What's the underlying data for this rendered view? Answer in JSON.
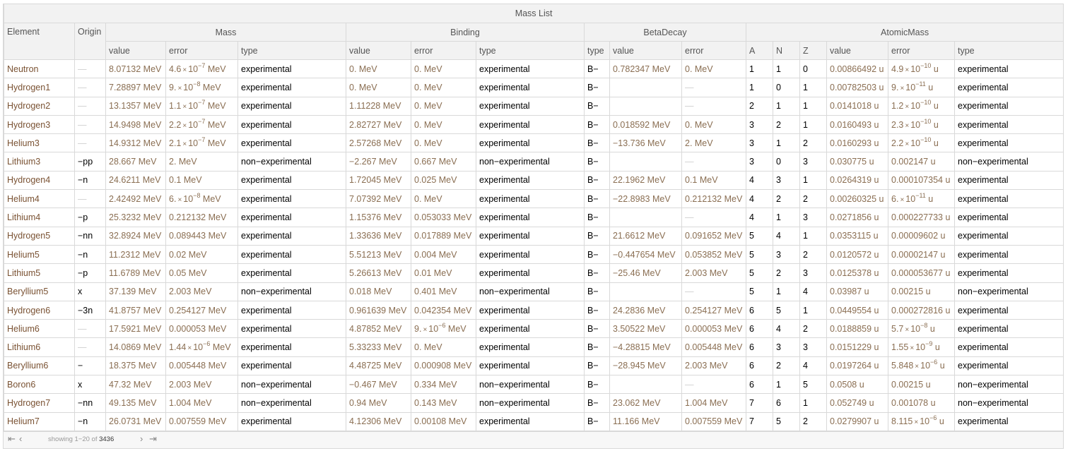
{
  "title": "Mass List",
  "headers": {
    "element": "Element",
    "origin": "Origin",
    "groups": [
      "Mass",
      "Binding",
      "BetaDecay",
      "AtomicMass"
    ],
    "sub": [
      "value",
      "error",
      "type",
      "value",
      "error",
      "type",
      "type",
      "value",
      "error",
      "A",
      "N",
      "Z",
      "value",
      "error",
      "type"
    ]
  },
  "rows": [
    [
      "Neutron",
      "—",
      "8.07132 MeV",
      "4.6×10^−7 MeV",
      "experimental",
      "0. MeV",
      "0. MeV",
      "experimental",
      "B−",
      "0.782347 MeV",
      "0. MeV",
      "1",
      "1",
      "0",
      "0.00866492 u",
      "4.9×10^−10 u",
      "experimental"
    ],
    [
      "Hydrogen1",
      "—",
      "7.28897 MeV",
      "9.×10^−8 MeV",
      "experimental",
      "0. MeV",
      "0. MeV",
      "experimental",
      "B−",
      "",
      "—",
      "1",
      "0",
      "1",
      "0.00782503 u",
      "9.×10^−11 u",
      "experimental"
    ],
    [
      "Hydrogen2",
      "—",
      "13.1357 MeV",
      "1.1×10^−7 MeV",
      "experimental",
      "1.11228 MeV",
      "0. MeV",
      "experimental",
      "B−",
      "",
      "—",
      "2",
      "1",
      "1",
      "0.0141018 u",
      "1.2×10^−10 u",
      "experimental"
    ],
    [
      "Hydrogen3",
      "—",
      "14.9498 MeV",
      "2.2×10^−7 MeV",
      "experimental",
      "2.82727 MeV",
      "0. MeV",
      "experimental",
      "B−",
      "0.018592 MeV",
      "0. MeV",
      "3",
      "2",
      "1",
      "0.0160493 u",
      "2.3×10^−10 u",
      "experimental"
    ],
    [
      "Helium3",
      "—",
      "14.9312 MeV",
      "2.1×10^−7 MeV",
      "experimental",
      "2.57268 MeV",
      "0. MeV",
      "experimental",
      "B−",
      "−13.736 MeV",
      "2. MeV",
      "3",
      "1",
      "2",
      "0.0160293 u",
      "2.2×10^−10 u",
      "experimental"
    ],
    [
      "Lithium3",
      "−pp",
      "28.667 MeV",
      "2. MeV",
      "non−experimental",
      "−2.267 MeV",
      "0.667 MeV",
      "non−experimental",
      "B−",
      "",
      "—",
      "3",
      "0",
      "3",
      "0.030775 u",
      "0.002147 u",
      "non−experimental"
    ],
    [
      "Hydrogen4",
      "−n",
      "24.6211 MeV",
      "0.1 MeV",
      "experimental",
      "1.72045 MeV",
      "0.025 MeV",
      "experimental",
      "B−",
      "22.1962 MeV",
      "0.1 MeV",
      "4",
      "3",
      "1",
      "0.0264319 u",
      "0.000107354 u",
      "experimental"
    ],
    [
      "Helium4",
      "—",
      "2.42492 MeV",
      "6.×10^−8 MeV",
      "experimental",
      "7.07392 MeV",
      "0. MeV",
      "experimental",
      "B−",
      "−22.8983 MeV",
      "0.212132 MeV",
      "4",
      "2",
      "2",
      "0.00260325 u",
      "6.×10^−11 u",
      "experimental"
    ],
    [
      "Lithium4",
      "−p",
      "25.3232 MeV",
      "0.212132 MeV",
      "experimental",
      "1.15376 MeV",
      "0.053033 MeV",
      "experimental",
      "B−",
      "",
      "—",
      "4",
      "1",
      "3",
      "0.0271856 u",
      "0.000227733 u",
      "experimental"
    ],
    [
      "Hydrogen5",
      "−nn",
      "32.8924 MeV",
      "0.089443 MeV",
      "experimental",
      "1.33636 MeV",
      "0.017889 MeV",
      "experimental",
      "B−",
      "21.6612 MeV",
      "0.091652 MeV",
      "5",
      "4",
      "1",
      "0.0353115 u",
      "0.00009602 u",
      "experimental"
    ],
    [
      "Helium5",
      "−n",
      "11.2312 MeV",
      "0.02 MeV",
      "experimental",
      "5.51213 MeV",
      "0.004 MeV",
      "experimental",
      "B−",
      "−0.447654 MeV",
      "0.053852 MeV",
      "5",
      "3",
      "2",
      "0.0120572 u",
      "0.00002147 u",
      "experimental"
    ],
    [
      "Lithium5",
      "−p",
      "11.6789 MeV",
      "0.05 MeV",
      "experimental",
      "5.26613 MeV",
      "0.01 MeV",
      "experimental",
      "B−",
      "−25.46 MeV",
      "2.003 MeV",
      "5",
      "2",
      "3",
      "0.0125378 u",
      "0.000053677 u",
      "experimental"
    ],
    [
      "Beryllium5",
      "x",
      "37.139 MeV",
      "2.003 MeV",
      "non−experimental",
      "0.018 MeV",
      "0.401 MeV",
      "non−experimental",
      "B−",
      "",
      "—",
      "5",
      "1",
      "4",
      "0.03987 u",
      "0.00215 u",
      "non−experimental"
    ],
    [
      "Hydrogen6",
      "−3n",
      "41.8757 MeV",
      "0.254127 MeV",
      "experimental",
      "0.961639 MeV",
      "0.042354 MeV",
      "experimental",
      "B−",
      "24.2836 MeV",
      "0.254127 MeV",
      "6",
      "5",
      "1",
      "0.0449554 u",
      "0.000272816 u",
      "experimental"
    ],
    [
      "Helium6",
      "—",
      "17.5921 MeV",
      "0.000053 MeV",
      "experimental",
      "4.87852 MeV",
      "9.×10^−6 MeV",
      "experimental",
      "B−",
      "3.50522 MeV",
      "0.000053 MeV",
      "6",
      "4",
      "2",
      "0.0188859 u",
      "5.7×10^−8 u",
      "experimental"
    ],
    [
      "Lithium6",
      "—",
      "14.0869 MeV",
      "1.44×10^−6 MeV",
      "experimental",
      "5.33233 MeV",
      "0. MeV",
      "experimental",
      "B−",
      "−4.28815 MeV",
      "0.005448 MeV",
      "6",
      "3",
      "3",
      "0.0151229 u",
      "1.55×10^−9 u",
      "experimental"
    ],
    [
      "Beryllium6",
      "−",
      "18.375 MeV",
      "0.005448 MeV",
      "experimental",
      "4.48725 MeV",
      "0.000908 MeV",
      "experimental",
      "B−",
      "−28.945 MeV",
      "2.003 MeV",
      "6",
      "2",
      "4",
      "0.0197264 u",
      "5.848×10^−6 u",
      "experimental"
    ],
    [
      "Boron6",
      "x",
      "47.32 MeV",
      "2.003 MeV",
      "non−experimental",
      "−0.467 MeV",
      "0.334 MeV",
      "non−experimental",
      "B−",
      "",
      "—",
      "6",
      "1",
      "5",
      "0.0508 u",
      "0.00215 u",
      "non−experimental"
    ],
    [
      "Hydrogen7",
      "−nn",
      "49.135 MeV",
      "1.004 MeV",
      "non−experimental",
      "0.94 MeV",
      "0.143 MeV",
      "non−experimental",
      "B−",
      "23.062 MeV",
      "1.004 MeV",
      "7",
      "6",
      "1",
      "0.052749 u",
      "0.001078 u",
      "non−experimental"
    ],
    [
      "Helium7",
      "−n",
      "26.0731 MeV",
      "0.007559 MeV",
      "experimental",
      "4.12306 MeV",
      "0.00108 MeV",
      "experimental",
      "B−",
      "11.166 MeV",
      "0.007559 MeV",
      "7",
      "5",
      "2",
      "0.0279907 u",
      "8.115×10^−6 u",
      "experimental"
    ]
  ],
  "footer": {
    "showing": "showing 1−20 of",
    "total": "3436",
    "icons": [
      "first-page-icon",
      "prev-page-icon",
      "next-page-icon",
      "last-page-icon"
    ]
  },
  "colors": {
    "element": "#7a5233",
    "quantity": "#8a6e52",
    "header_bg": "#f2f2f2",
    "border": "#d9d9d9"
  }
}
